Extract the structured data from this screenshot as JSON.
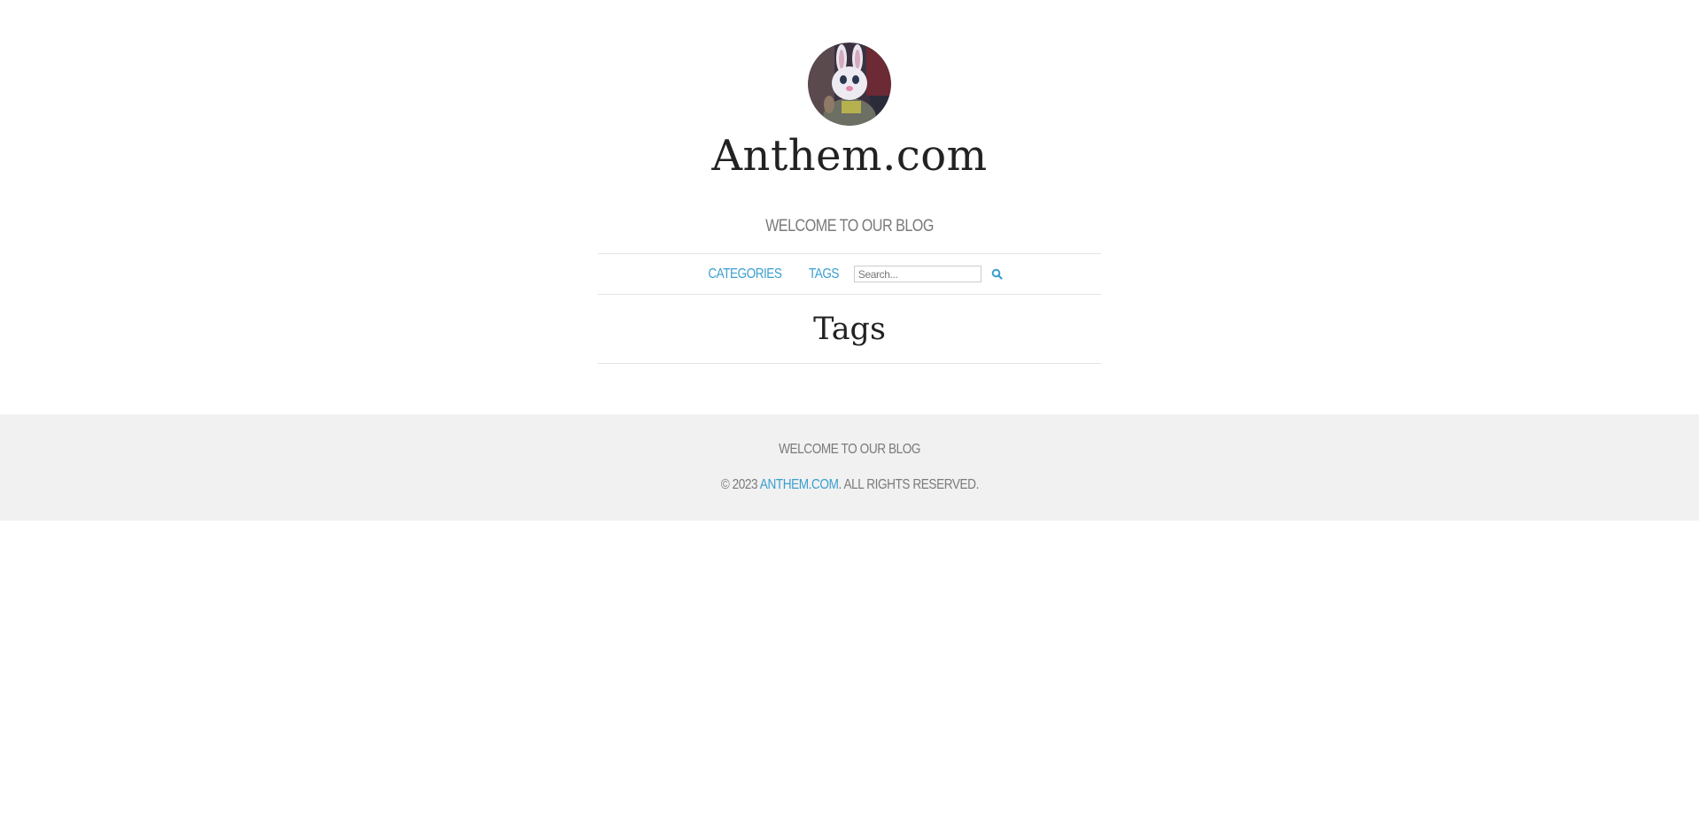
{
  "site": {
    "title": "Anthem.com",
    "tagline": "WELCOME TO OUR BLOG",
    "avatar_icon": "bunny-avatar"
  },
  "nav": {
    "items": [
      {
        "label": "CATEGORIES"
      },
      {
        "label": "TAGS"
      }
    ],
    "search_placeholder": "Search...",
    "search_icon": "search-icon"
  },
  "page": {
    "heading": "Tags"
  },
  "footer": {
    "tagline": "WELCOME TO OUR BLOG",
    "copyright_prefix": "© 2023",
    "site_link": "ANTHEM.COM",
    "copyright_suffix": ". ALL RIGHTS RESERVED."
  },
  "colors": {
    "accent": "#3a9fcf",
    "footer_bg": "#f1f1f1",
    "text_muted": "#7a7a7a"
  }
}
